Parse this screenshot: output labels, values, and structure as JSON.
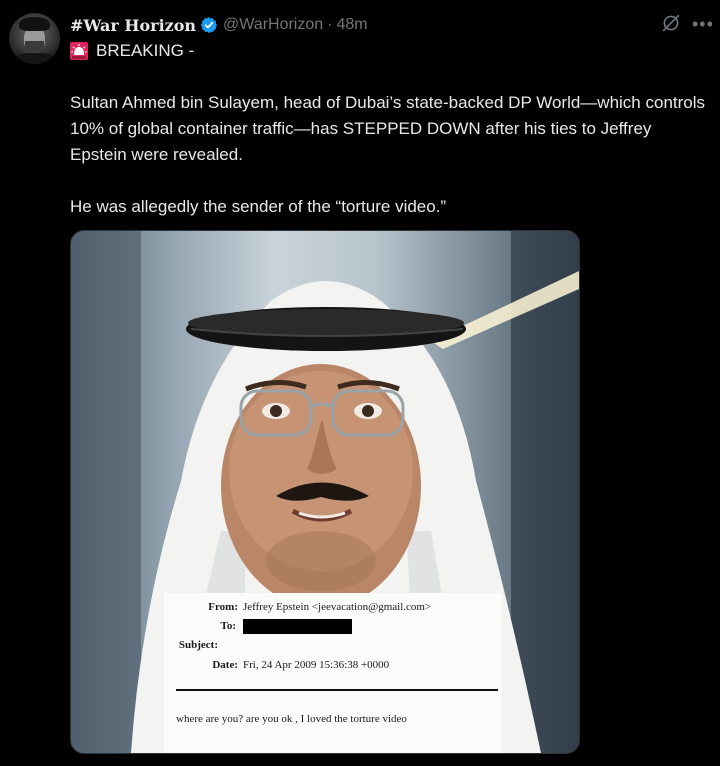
{
  "post": {
    "display_name": "#War Horizon",
    "handle": "@WarHorizon",
    "separator": "·",
    "timestamp": "48m",
    "breaking_label": "BREAKING -",
    "paragraph_1": "Sultan Ahmed bin Sulayem, head of Dubai’s state-backed DP World—which controls 10% of global container traffic—has STEPPED DOWN after his ties to Jeffrey Epstein were revealed.",
    "paragraph_2": "He was allegedly the sender of the “torture video.”"
  },
  "icons": {
    "avatar": "avatar",
    "verified": "verified-badge-icon",
    "siren": "rotating-light-emoji",
    "grok": "grok-icon",
    "more": "more-icon"
  },
  "colors": {
    "background": "#000000",
    "text": "#e7e9ea",
    "secondary": "#71767b",
    "verified": "#1d9bf0",
    "siren": "#e0245e"
  },
  "email": {
    "from_label": "From:",
    "from_value": "Jeffrey Epstein <jeevacation@gmail.com>",
    "to_label": "To:",
    "subject_label": "Subject:",
    "date_label": "Date:",
    "date_value": "Fri, 24 Apr 2009 15:36:38 +0000",
    "body": "where are you? are you ok , I loved the torture video"
  }
}
